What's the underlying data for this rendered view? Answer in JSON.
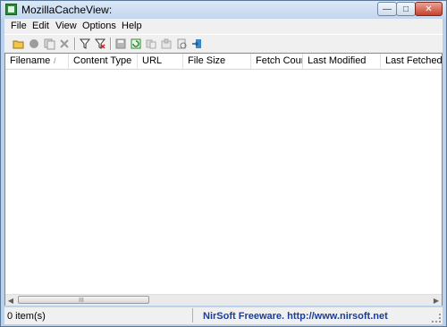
{
  "window": {
    "title": "MozillaCacheView:"
  },
  "menu": [
    "File",
    "Edit",
    "View",
    "Options",
    "Help"
  ],
  "toolbar": {
    "buttons": [
      "open-folder-icon",
      "stop-icon",
      "copy-icon",
      "delete-icon",
      "filter-icon",
      "filter-clear-icon",
      "save-icon",
      "refresh-icon",
      "copy-files-icon",
      "export-icon",
      "properties-icon",
      "exit-icon"
    ]
  },
  "columns": [
    "Filename",
    "Content Type",
    "URL",
    "File Size",
    "Fetch Count",
    "Last Modified",
    "Last Fetched"
  ],
  "sort_indicator": "/",
  "scroll_grip": "III",
  "status": {
    "item_count": "0 item(s)",
    "link_text": "NirSoft Freeware.  http://www.nirsoft.net"
  },
  "colors": {
    "window_bg": "#b9d1ea",
    "link": "#1a3d9a"
  }
}
